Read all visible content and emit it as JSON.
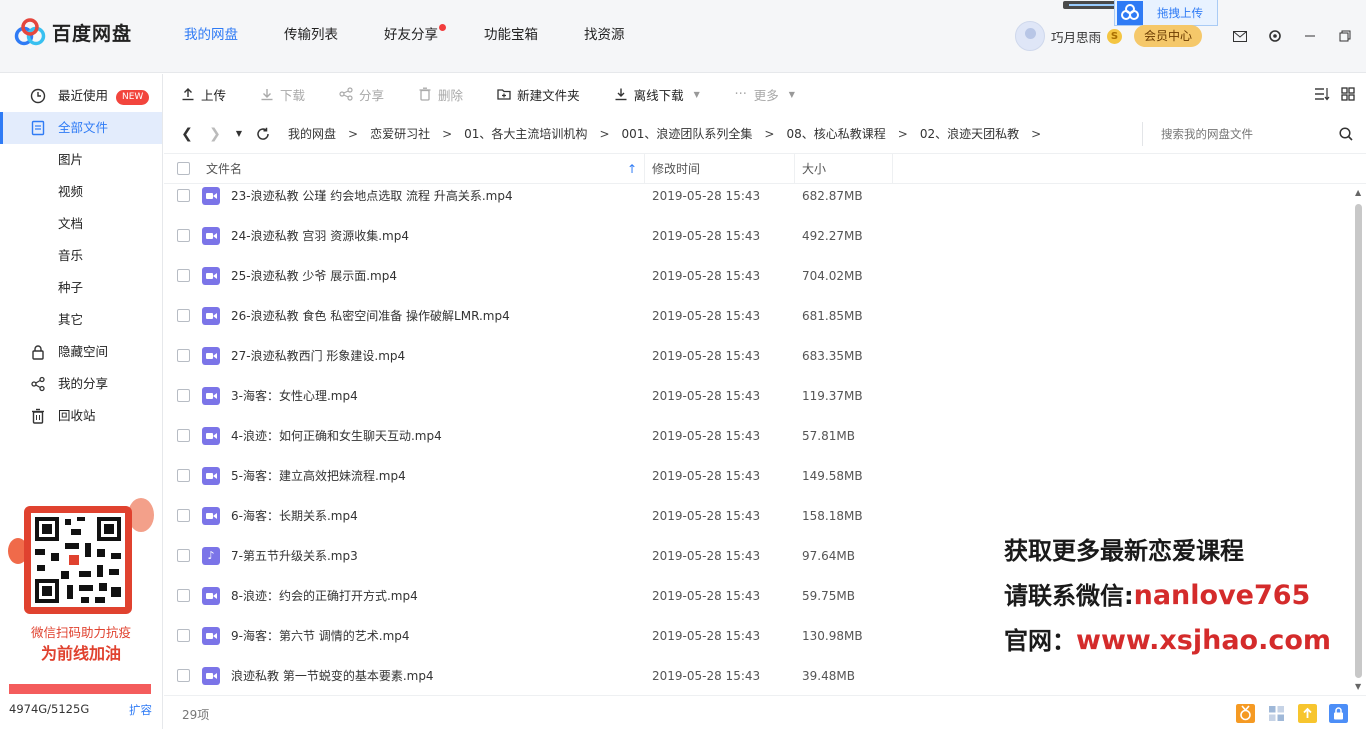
{
  "app": {
    "name": "百度网盘",
    "nav": [
      {
        "label": "我的网盘",
        "active": true
      },
      {
        "label": "传输列表"
      },
      {
        "label": "好友分享",
        "dot": true
      },
      {
        "label": "功能宝箱"
      },
      {
        "label": "找资源"
      }
    ],
    "user": {
      "name": "巧月思雨",
      "coin": "S",
      "vip_label": "会员中心"
    },
    "float_upload_label": "拖拽上传",
    "accent": "#2f7bf5"
  },
  "sidebar": {
    "items": [
      {
        "label": "最近使用",
        "icon": "clock-icon",
        "badge": "NEW"
      },
      {
        "label": "全部文件",
        "icon": "file-icon",
        "active": true
      },
      {
        "label": "隐藏空间",
        "icon": "lock-icon"
      },
      {
        "label": "我的分享",
        "icon": "share-icon"
      },
      {
        "label": "回收站",
        "icon": "trash-icon"
      }
    ],
    "subitems": [
      "图片",
      "视频",
      "文档",
      "音乐",
      "种子",
      "其它"
    ],
    "promo": {
      "line1": "微信扫码助力抗疫",
      "line2": "为前线加油"
    },
    "quota": {
      "text": "4974G/5125G",
      "used_fraction": 0.97,
      "expand_label": "扩容"
    }
  },
  "toolbar": {
    "upload": "上传",
    "download": "下载",
    "share": "分享",
    "delete": "删除",
    "new_folder": "新建文件夹",
    "offline_download": "离线下载",
    "more": "更多"
  },
  "breadcrumb": [
    "我的网盘",
    "恋爱研习社",
    "01、各大主流培训机构",
    "001、浪迹团队系列全集",
    "08、核心私教课程",
    "02、浪迹天团私教"
  ],
  "search": {
    "placeholder": "搜索我的网盘文件"
  },
  "columns": {
    "name": "文件名",
    "modified": "修改时间",
    "size": "大小"
  },
  "files": [
    {
      "name": "23-浪迹私教 公瑾 约会地点选取 流程 升高关系.mp4",
      "modified": "2019-05-28 15:43",
      "size": "682.87MB",
      "type": "video"
    },
    {
      "name": "24-浪迹私教 宫羽 资源收集.mp4",
      "modified": "2019-05-28 15:43",
      "size": "492.27MB",
      "type": "video"
    },
    {
      "name": "25-浪迹私教 少爷 展示面.mp4",
      "modified": "2019-05-28 15:43",
      "size": "704.02MB",
      "type": "video"
    },
    {
      "name": "26-浪迹私教 食色 私密空间准备 操作破解LMR.mp4",
      "modified": "2019-05-28 15:43",
      "size": "681.85MB",
      "type": "video"
    },
    {
      "name": "27-浪迹私教西门 形象建设.mp4",
      "modified": "2019-05-28 15:43",
      "size": "683.35MB",
      "type": "video"
    },
    {
      "name": "3-海客：女性心理.mp4",
      "modified": "2019-05-28 15:43",
      "size": "119.37MB",
      "type": "video"
    },
    {
      "name": "4-浪迹：如何正确和女生聊天互动.mp4",
      "modified": "2019-05-28 15:43",
      "size": "57.81MB",
      "type": "video"
    },
    {
      "name": "5-海客：建立高效把妹流程.mp4",
      "modified": "2019-05-28 15:43",
      "size": "149.58MB",
      "type": "video"
    },
    {
      "name": "6-海客：长期关系.mp4",
      "modified": "2019-05-28 15:43",
      "size": "158.18MB",
      "type": "video"
    },
    {
      "name": "7-第五节升级关系.mp3",
      "modified": "2019-05-28 15:43",
      "size": "97.64MB",
      "type": "audio"
    },
    {
      "name": "8-浪迹：约会的正确打开方式.mp4",
      "modified": "2019-05-28 15:43",
      "size": "59.75MB",
      "type": "video"
    },
    {
      "name": "9-海客：第六节 调情的艺术.mp4",
      "modified": "2019-05-28 15:43",
      "size": "130.98MB",
      "type": "video"
    },
    {
      "name": "浪迹私教 第一节蜕变的基本要素.mp4",
      "modified": "2019-05-28 15:43",
      "size": "39.48MB",
      "type": "video"
    }
  ],
  "footer": {
    "count": "29项"
  },
  "watermark": {
    "line1": "获取更多最新恋爱课程",
    "line2_prefix": "请联系微信:",
    "line2_value": "nanlove765",
    "line3_prefix": "官网：",
    "line3_value": "www.xsjhao.com"
  }
}
